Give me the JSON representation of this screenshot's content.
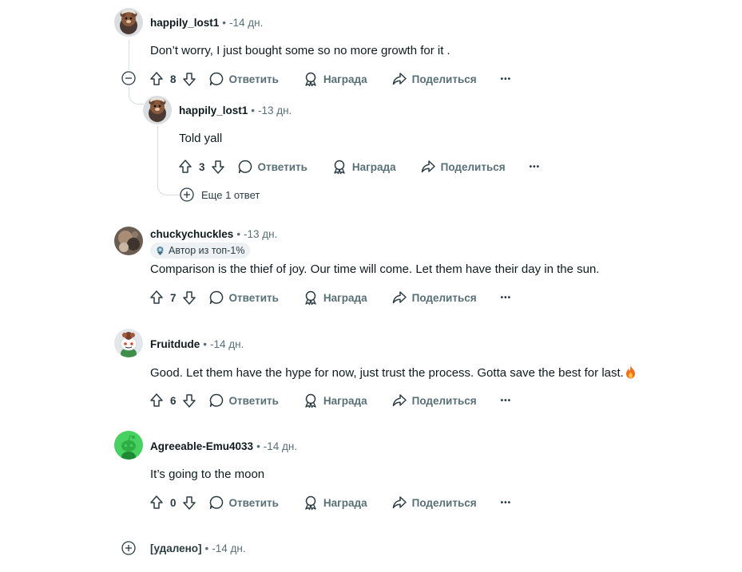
{
  "comments": [
    {
      "author": "happily_lost1",
      "sep": "•",
      "time": "-14 дн.",
      "body": "Don’t worry, I just bought some so no more growth for it .",
      "votes": "8",
      "avatar": "bear-avatar-icon"
    },
    {
      "author": "happily_lost1",
      "sep": "•",
      "time": "-13 дн.",
      "body": "Told yall",
      "votes": "3",
      "avatar": "bear-avatar-icon"
    },
    {
      "author": "chuckychuckles",
      "sep": "•",
      "time": "-13 дн.",
      "badge": "Автор из топ-1%",
      "body": "Comparison is the thief of joy. Our time will come. Let them have their day in the sun.",
      "votes": "7",
      "avatar": "photo-avatar-icon"
    },
    {
      "author": "Fruitdude",
      "sep": "•",
      "time": "-14 дн.",
      "body": "Good. Let them have the hype for now, just trust the process. Gotta save the best for last.",
      "body_emoji": "fire-emoji-icon",
      "votes": "6",
      "avatar": "snoo-avatar-icon"
    },
    {
      "author": "Agreeable-Emu4033",
      "sep": "•",
      "time": "-14 дн.",
      "body": "It’s going to the moon",
      "votes": "0",
      "avatar": "green-snoo-avatar-icon"
    },
    {
      "author": "[удалено]",
      "sep": "•",
      "time": "-14 дн."
    }
  ],
  "actions": {
    "reply": "Ответить",
    "award": "Награда",
    "share": "Поделиться",
    "more": "•••"
  },
  "more_replies": "Еще 1 ответ",
  "colors": {
    "text": "#0f1a1c",
    "muted": "#576f76",
    "thread": "#d7dde0",
    "badge_bg": "#eef1f3",
    "green_avatar": "#46d160"
  }
}
